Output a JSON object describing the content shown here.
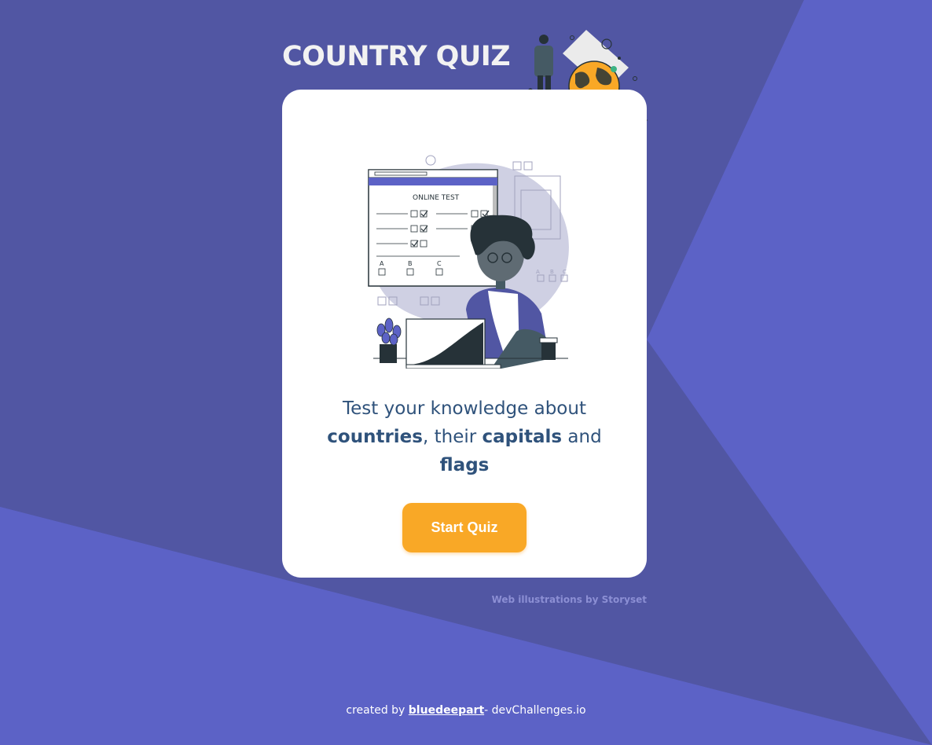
{
  "header": {
    "title": "COUNTRY QUIZ"
  },
  "illustration": {
    "online_test_heading": "ONLINE TEST",
    "option_labels": [
      "A",
      "B",
      "C"
    ]
  },
  "card": {
    "description_part1": "Test your knowledge about ",
    "description_countries": "countries",
    "description_part2": ", their ",
    "description_capitals": "capitals",
    "description_part3": " and ",
    "description_flags": "flags",
    "start_button_label": "Start Quiz"
  },
  "credit": {
    "text": "Web illustrations by Storyset"
  },
  "footer": {
    "prefix": "created by ",
    "author": "bluedeepart",
    "suffix": "- devChallenges.io"
  },
  "colors": {
    "background": "#5C62C6",
    "background_shade": "#5156A3",
    "card": "#FFFFFF",
    "accent": "#F9A826",
    "text_primary": "#2F527B",
    "title": "#F2F2F2"
  }
}
